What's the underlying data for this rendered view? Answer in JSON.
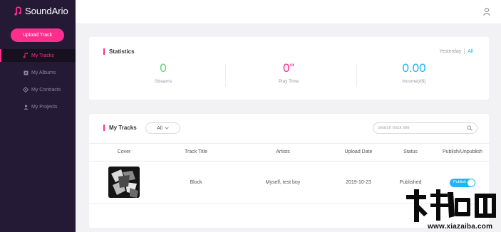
{
  "app": {
    "name": "SoundArio",
    "brand_color": "#ff2d8d",
    "accent_color": "#1fb6f1"
  },
  "sidebar": {
    "upload_label": "Upload Track",
    "items": [
      {
        "label": "My Tracks",
        "icon": "music-note-icon",
        "active": true
      },
      {
        "label": "My Albums",
        "icon": "album-icon",
        "active": false
      },
      {
        "label": "My Contracts",
        "icon": "contract-icon",
        "active": false
      },
      {
        "label": "My Projects",
        "icon": "user-icon",
        "active": false
      }
    ]
  },
  "header": {
    "icon": "user-account-icon"
  },
  "statistics": {
    "title": "Statistics",
    "period": {
      "yesterday": "Yesterday",
      "all": "All",
      "selected": "All"
    },
    "items": [
      {
        "value": "0",
        "label": "Streams",
        "color": "#5fd37a"
      },
      {
        "value": "0''",
        "label": "Play Time",
        "color": "#ff2d8d"
      },
      {
        "value": "0.00",
        "label": "Income(d$)",
        "color": "#1fb6f1"
      }
    ]
  },
  "tracks": {
    "title": "My Tracks",
    "filter": "All",
    "search_placeholder": "Search track title",
    "columns": [
      "Cover",
      "Track Title",
      "Artists",
      "Upload Date",
      "Status",
      "Publish/Unpublish"
    ],
    "rows": [
      {
        "title": "Block",
        "artists": "Myself, test boy",
        "upload_date": "2019-10-23",
        "status": "Published",
        "toggle_label": "Publish",
        "published": true
      }
    ]
  },
  "watermark": {
    "url": "www.xiazaiba.com"
  }
}
